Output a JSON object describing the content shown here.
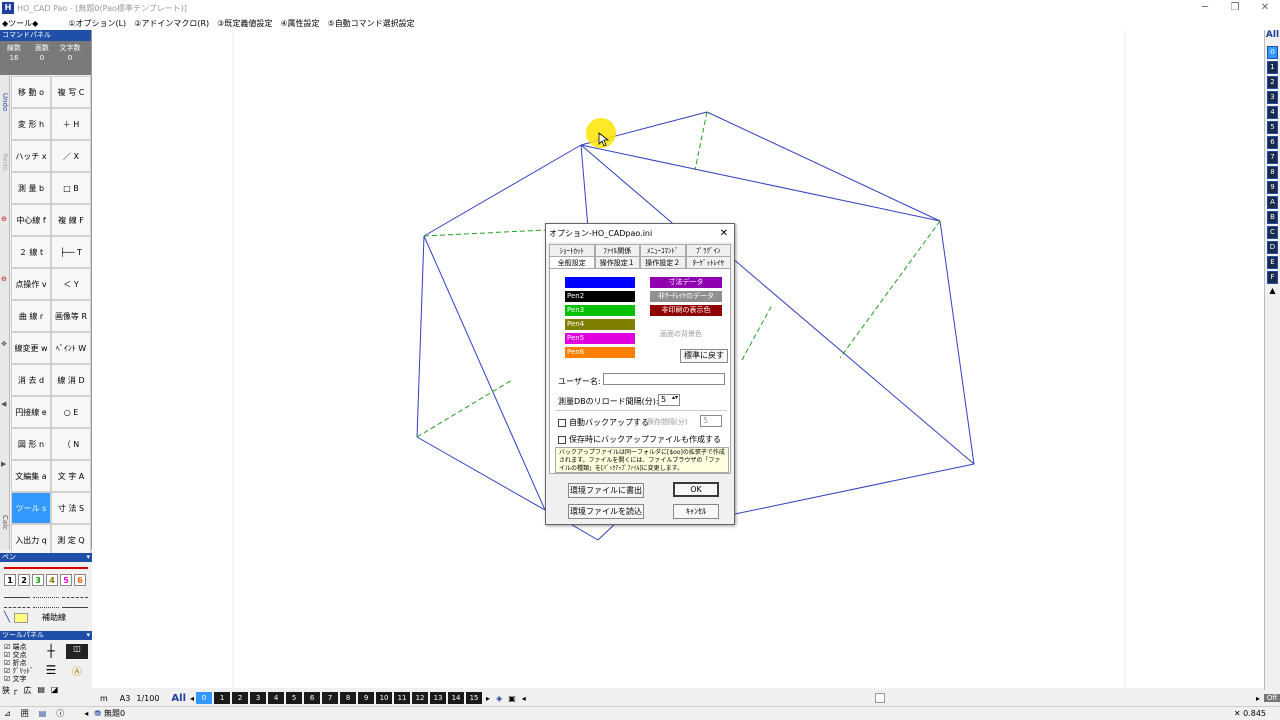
{
  "window": {
    "title": "HO_CAD Pao - [無題0(Pao標準テンプレート)]",
    "app_icon": "H"
  },
  "menu": [
    "◆ツール◆",
    "①オプション(L)",
    "②アドインマクロ(R)",
    "③既定義値設定",
    "④属性設定",
    "⑤自動コマンド選択設定"
  ],
  "cmdpanel": {
    "title": "コマンドパネル",
    "counts": [
      {
        "label": "線数",
        "value": "16"
      },
      {
        "label": "面数",
        "value": "0"
      },
      {
        "label": "文字数",
        "value": "0"
      }
    ],
    "side_labels": [
      "Undo",
      "Redo",
      "Calc"
    ],
    "buttons": [
      "移 動 o",
      "複 写 C",
      "変 形 h",
      "＋ H",
      "ハッチ x",
      "／ X",
      "測 量 b",
      "□ B",
      "中心線 f",
      "複 線 F",
      "２ 線 t",
      "├── T",
      "点操作 v",
      "＜ Y",
      "曲 線 r",
      "画像等 R",
      "線変更 w",
      "ﾍﾟｲﾝﾄ W",
      "消 去 d",
      "線 消 D",
      "円接線 e",
      "○ E",
      "図 形 n",
      "（ N",
      "文編集 a",
      "文 字 A",
      "ツール s",
      "寸 法 S",
      "入出力 q",
      "測 定 Q"
    ],
    "active": "ツール s"
  },
  "penpanel": {
    "title": "ペン",
    "numbers": [
      "1",
      "2",
      "3",
      "4",
      "5",
      "6"
    ],
    "helper": "補助線"
  },
  "toolpanel": {
    "title": "ツールパネル",
    "checks": [
      "端点",
      "交点",
      "折点",
      "ｸﾞﾘｯﾄﾞ",
      "文字"
    ]
  },
  "statusbar": {
    "unit": "m",
    "paper": "A3",
    "scale": "1/100",
    "all": "All",
    "layers": [
      "0",
      "1",
      "2",
      "3",
      "4",
      "5",
      "6",
      "7",
      "8",
      "9",
      "10",
      "11",
      "12",
      "13",
      "14",
      "15"
    ]
  },
  "right": {
    "all": "All",
    "layers": [
      "0",
      "1",
      "2",
      "3",
      "4",
      "5",
      "6",
      "7",
      "8",
      "9",
      "A",
      "B",
      "C",
      "D",
      "E",
      "F"
    ],
    "off": "Off"
  },
  "bottom": {
    "zoom": "0.845",
    "file": "無題0"
  },
  "dialog": {
    "title": "オプション-HO_CADpao.ini",
    "tabs_row1": [
      "ｼｮｰﾄｶｯﾄ",
      "ﾌｧｲﾙ関係",
      "ﾒﾆｭｰｺﾏﾝﾄﾞ",
      "ﾌﾟﾗｸﾞｲﾝ"
    ],
    "tabs_row2": [
      "全般設定",
      "操作設定１",
      "操作設定２",
      "ﾀｰｹﾞｯﾄﾚｲﾔ"
    ],
    "pens": [
      {
        "label": "Pen1",
        "color": "#0000ff"
      },
      {
        "label": "Pen2",
        "color": "#000000"
      },
      {
        "label": "Pen3",
        "color": "#00c000"
      },
      {
        "label": "Pen4",
        "color": "#808000"
      },
      {
        "label": "Pen5",
        "color": "#e000e0"
      },
      {
        "label": "Pen6",
        "color": "#ff8000"
      }
    ],
    "special": [
      {
        "label": "寸法データ",
        "color": "#9000b0"
      },
      {
        "label": "非ｻｰﾁﾚｲﾔのデータ",
        "color": "#909090"
      },
      {
        "label": "非印刷の表示色",
        "color": "#900000"
      }
    ],
    "bg_label": "画面の背景色",
    "reset": "標準に戻す",
    "user_label": "ユーザー名:",
    "user_value": "",
    "reload_label": "測量DBのリロード間隔(分):",
    "reload_value": "5",
    "auto_backup": "自動バックアップする",
    "backup_interval_label": "保存間隔(分)",
    "backup_interval_value": "5",
    "save_backup": "保存時にバックアップファイルも作成する",
    "note": "バックアップファイルは同一フォルダに[$oo]の拡張子で作成されます。ファイルを開くには、ファイルブラウザの「ファイルの種類」を[ﾊﾞｯｸｱｯﾌﾟﾌｧｲﾙ]に変更します。",
    "export": "環境ファイルに書出",
    "import": "環境ファイルを読込",
    "ok": "OK",
    "cancel": "ｷｬﾝｾﾙ"
  }
}
